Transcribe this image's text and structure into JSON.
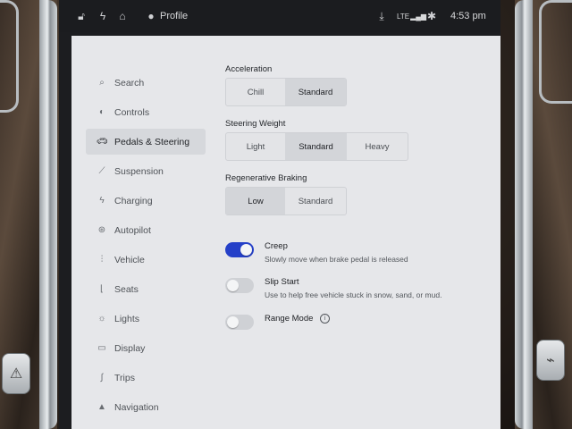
{
  "statusbar": {
    "profile_label": "Profile",
    "network": "LTE",
    "time": "4:53 pm"
  },
  "sidebar": {
    "items": [
      {
        "label": "Search",
        "icon": "search-icon"
      },
      {
        "label": "Controls",
        "icon": "toggle-icon"
      },
      {
        "label": "Pedals & Steering",
        "icon": "car-icon",
        "active": true
      },
      {
        "label": "Suspension",
        "icon": "suspension-icon"
      },
      {
        "label": "Charging",
        "icon": "bolt-icon"
      },
      {
        "label": "Autopilot",
        "icon": "steering-wheel-icon"
      },
      {
        "label": "Vehicle",
        "icon": "sliders-icon"
      },
      {
        "label": "Seats",
        "icon": "seat-icon"
      },
      {
        "label": "Lights",
        "icon": "sun-icon"
      },
      {
        "label": "Display",
        "icon": "display-icon"
      },
      {
        "label": "Trips",
        "icon": "trips-icon"
      },
      {
        "label": "Navigation",
        "icon": "navigation-icon"
      }
    ]
  },
  "settings": {
    "acceleration": {
      "label": "Acceleration",
      "options": [
        "Chill",
        "Standard"
      ],
      "selected": "Standard"
    },
    "steering_weight": {
      "label": "Steering Weight",
      "options": [
        "Light",
        "Standard",
        "Heavy"
      ],
      "selected": "Standard"
    },
    "regen_braking": {
      "label": "Regenerative Braking",
      "options": [
        "Low",
        "Standard"
      ],
      "selected": "Low"
    },
    "creep": {
      "title": "Creep",
      "desc": "Slowly move when brake pedal is released",
      "on": true
    },
    "slip_start": {
      "title": "Slip Start",
      "desc": "Use to help free vehicle stuck in snow, sand, or mud.",
      "on": false
    },
    "range_mode": {
      "title": "Range Mode",
      "on": false
    }
  },
  "colors": {
    "toggle_on": "#2540c8",
    "panel_bg": "#e6e7ea"
  }
}
